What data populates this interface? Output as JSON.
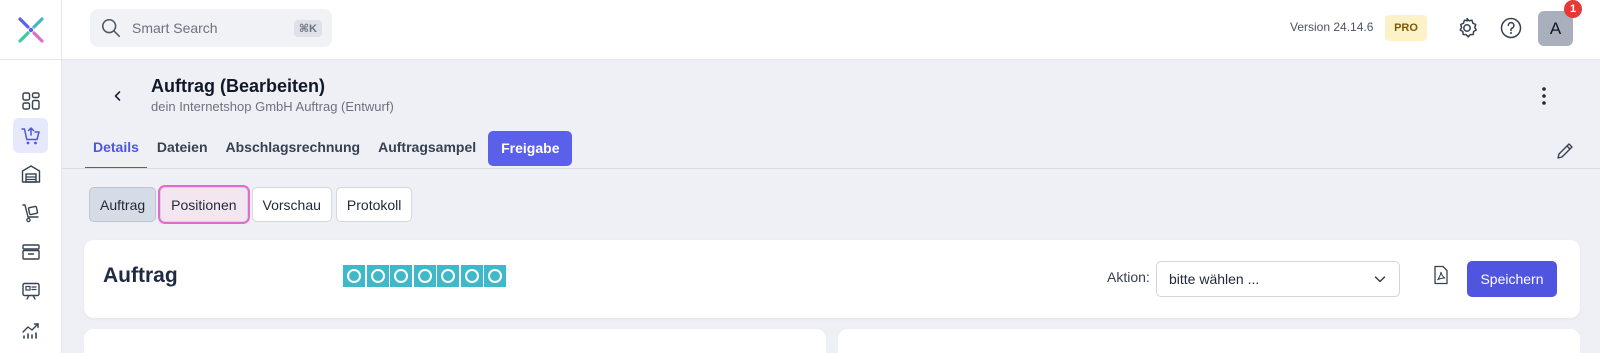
{
  "header": {
    "search_placeholder": "Smart Search",
    "search_shortcut": "⌘K",
    "version": "Version 24.14.6",
    "plan_badge": "PRO",
    "avatar_initial": "A",
    "notification_count": "1"
  },
  "sidebar": {
    "items": [
      {
        "icon": "dashboard-icon",
        "active": false
      },
      {
        "icon": "cart-icon",
        "active": true
      },
      {
        "icon": "warehouse-icon",
        "active": false
      },
      {
        "icon": "trolley-icon",
        "active": false
      },
      {
        "icon": "archive-box-icon",
        "active": false
      },
      {
        "icon": "presentation-icon",
        "active": false
      },
      {
        "icon": "growth-chart-icon",
        "active": false
      }
    ]
  },
  "page": {
    "title": "Auftrag (Bearbeiten)",
    "subtitle": "dein Internetshop GmbH Auftrag (Entwurf)"
  },
  "tabs": [
    {
      "label": "Details",
      "active": true
    },
    {
      "label": "Dateien",
      "active": false
    },
    {
      "label": "Abschlagsrechnung",
      "active": false
    },
    {
      "label": "Auftragsampel",
      "active": false
    },
    {
      "label": "Freigabe",
      "primary": true
    }
  ],
  "subtabs": [
    {
      "label": "Auftrag",
      "active": true
    },
    {
      "label": "Positionen",
      "focused": true
    },
    {
      "label": "Vorschau"
    },
    {
      "label": "Protokoll"
    }
  ],
  "card": {
    "title": "Auftrag",
    "status_count": 7,
    "aktion_label": "Aktion:",
    "aktion_value": "bitte wählen ...",
    "save_label": "Speichern"
  },
  "colors": {
    "accent": "#4f55e0",
    "status_teal": "#3fb8c9",
    "badge_bg": "#fdf1c7",
    "notification": "#e53935"
  }
}
